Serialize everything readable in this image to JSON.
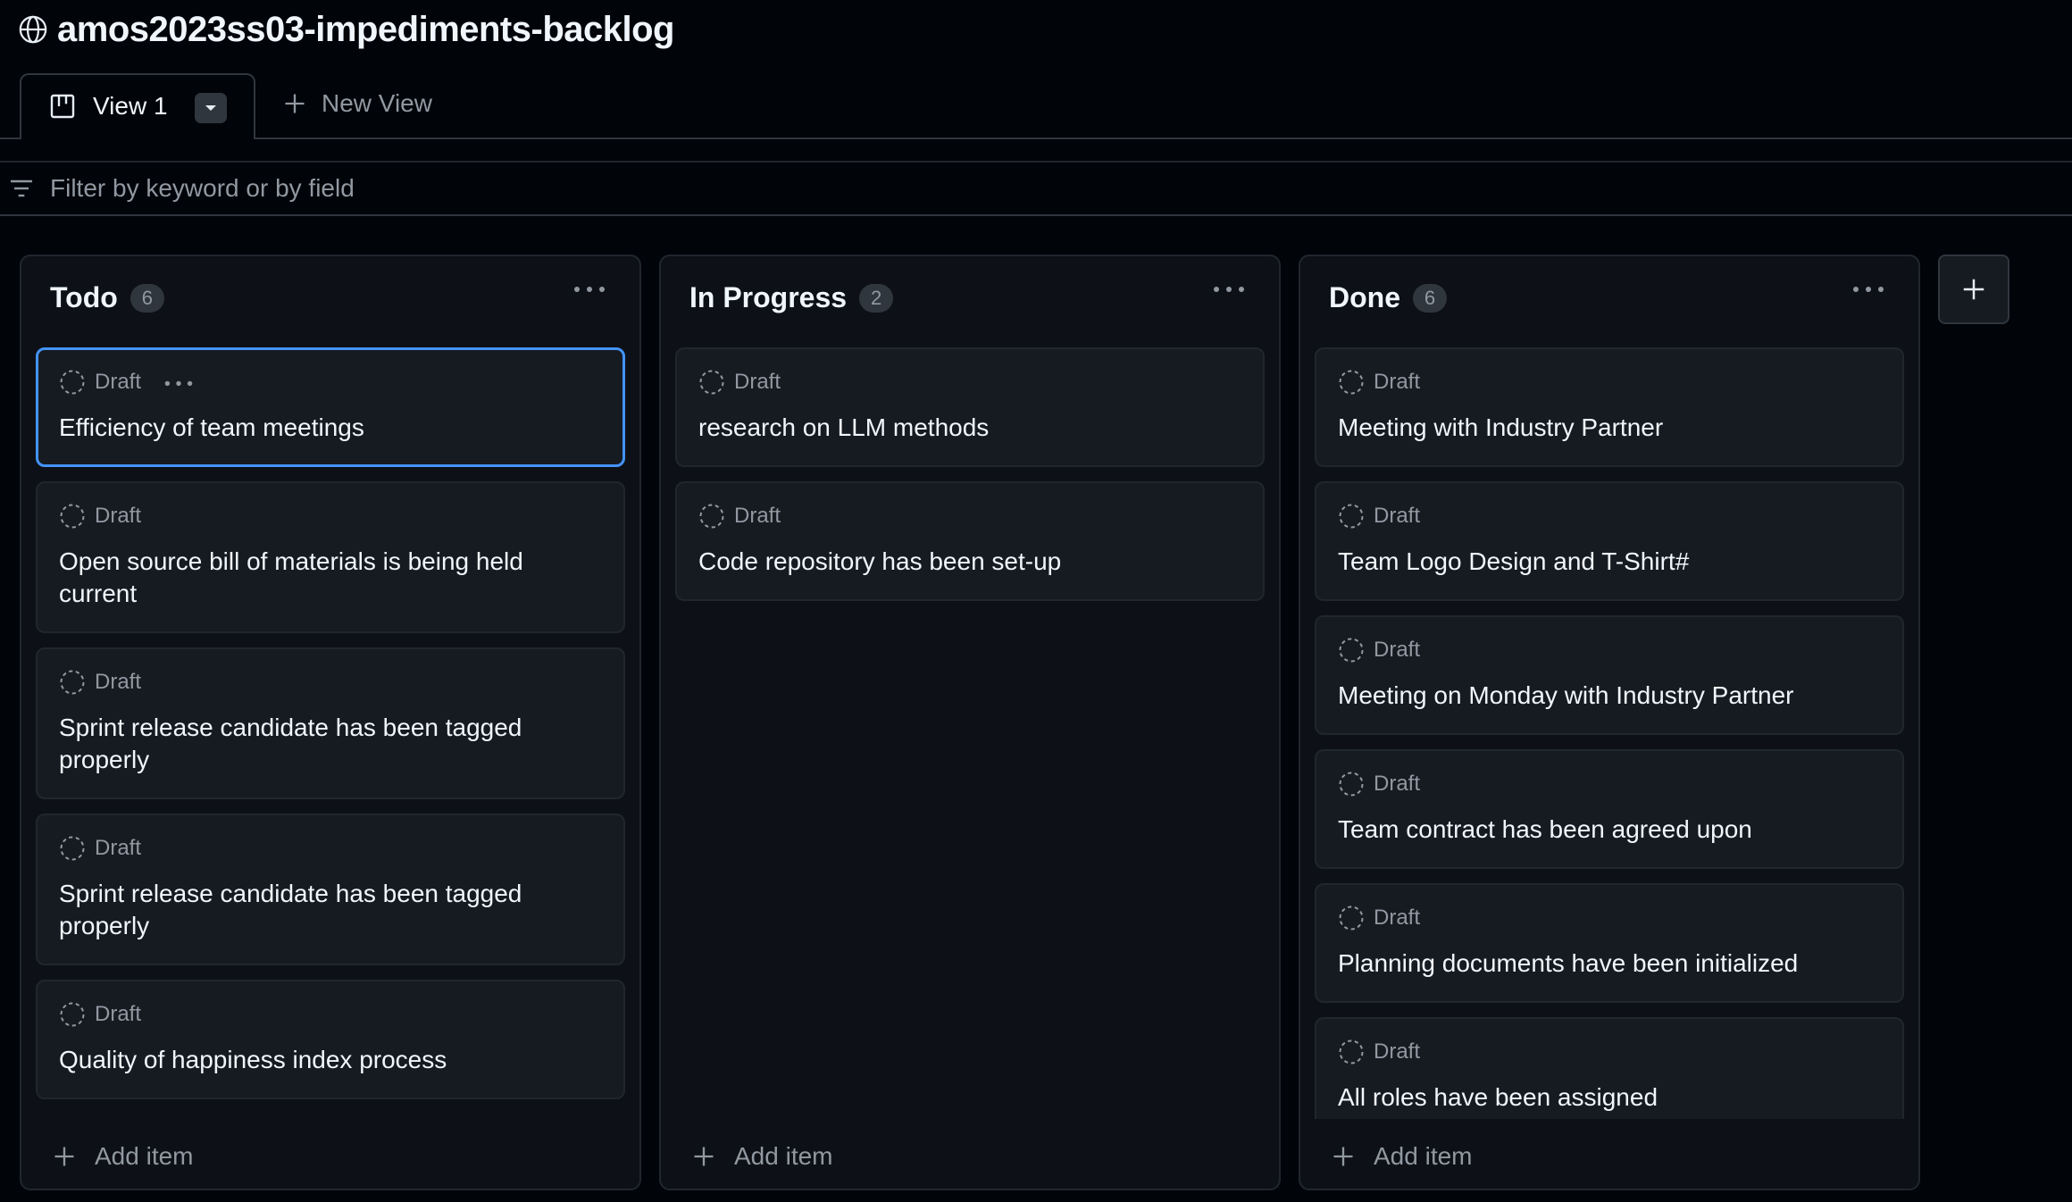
{
  "project": {
    "title": "amos2023ss03-impediments-backlog",
    "icon": "globe-icon"
  },
  "tabs": {
    "active": {
      "label": "View 1",
      "icon": "board-icon"
    },
    "new_view_label": "New View"
  },
  "filter": {
    "placeholder": "Filter by keyword or by field"
  },
  "columns": [
    {
      "title": "Todo",
      "count": "6",
      "cards": [
        {
          "status": "Draft",
          "title": "Efficiency of team meetings"
        },
        {
          "status": "Draft",
          "title": "Open source bill of materials is being held current"
        },
        {
          "status": "Draft",
          "title": "Sprint release candidate has been tagged properly"
        },
        {
          "status": "Draft",
          "title": "Sprint release candidate has been tagged properly"
        },
        {
          "status": "Draft",
          "title": "Quality of happiness index process"
        }
      ],
      "add_label": "Add item"
    },
    {
      "title": "In Progress",
      "count": "2",
      "cards": [
        {
          "status": "Draft",
          "title": "research on LLM methods"
        },
        {
          "status": "Draft",
          "title": "Code repository has been set-up"
        }
      ],
      "add_label": "Add item"
    },
    {
      "title": "Done",
      "count": "6",
      "cards": [
        {
          "status": "Draft",
          "title": "Meeting with Industry Partner"
        },
        {
          "status": "Draft",
          "title": "Team Logo Design and T-Shirt#"
        },
        {
          "status": "Draft",
          "title": "Meeting on Monday with Industry Partner"
        },
        {
          "status": "Draft",
          "title": "Team contract has been agreed upon"
        },
        {
          "status": "Draft",
          "title": "Planning documents have been initialized"
        },
        {
          "status": "Draft",
          "title": "All roles have been assigned"
        }
      ],
      "add_label": "Add item"
    }
  ],
  "colors": {
    "background": "#010409",
    "column": "#0d1117",
    "card": "#161b22",
    "selected_border": "#4493f8",
    "muted": "#9198a1"
  }
}
